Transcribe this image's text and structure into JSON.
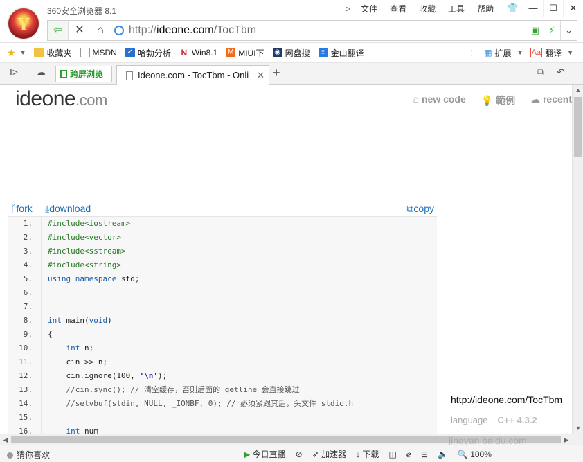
{
  "app": {
    "title": "360安全浏览器 8.1",
    "logo_glyph": "Y",
    "menu": [
      "文件",
      "查看",
      "收藏",
      "工具",
      "帮助"
    ],
    "window_buttons": [
      "👕",
      "—",
      "☐",
      "✕"
    ]
  },
  "address_bar": {
    "scheme": "http://",
    "host": "ideone.com",
    "path": "/TocTbm",
    "back_glyph": "⇦",
    "stop_glyph": "✕",
    "home_glyph": "⌂"
  },
  "favorites": [
    {
      "label": "收藏夹",
      "icon": "folder-icon",
      "color": "#f3c242",
      "glyph": ""
    },
    {
      "label": "MSDN",
      "icon": "page-icon",
      "color": "#9a9a9a",
      "glyph": ""
    },
    {
      "label": "哈勃分析",
      "icon": "shield-icon",
      "color": "#2a6fd0",
      "glyph": "✓"
    },
    {
      "label": "Win8.1",
      "icon": "n-logo-icon",
      "color": "#c1272d",
      "glyph": "N"
    },
    {
      "label": "MIUI下",
      "icon": "miui-icon",
      "color": "#f26b1d",
      "glyph": "M"
    },
    {
      "label": "网盘搜",
      "icon": "search-paw-icon",
      "color": "#1f3b6b",
      "glyph": "◉"
    },
    {
      "label": "金山翻译",
      "icon": "translate-icon",
      "color": "#2a7be0",
      "glyph": "☺"
    }
  ],
  "favbar_right": {
    "extend": "扩展",
    "translate": "翻译"
  },
  "tabs": {
    "split_label": "跨屏浏览",
    "active_title": "Ideone.com - TocTbm - Onli"
  },
  "site": {
    "brand_main": "ideone",
    "brand_tld": ".com",
    "nav": [
      "new code",
      "範例",
      "recent"
    ],
    "actions": {
      "fork": "fork",
      "download": "download",
      "copy": "copy"
    },
    "code_lines": [
      {
        "n": "1.",
        "html": "<span class=\"pp\">#include&lt;iostream&gt;</span>"
      },
      {
        "n": "2.",
        "html": "<span class=\"pp\">#include&lt;vector&gt;</span>"
      },
      {
        "n": "3.",
        "html": "<span class=\"pp\">#include&lt;sstream&gt;</span>"
      },
      {
        "n": "4.",
        "html": "<span class=\"pp\">#include&lt;string&gt;</span>"
      },
      {
        "n": "5.",
        "html": "<span class=\"kw\">using namespace</span> std;"
      },
      {
        "n": "6.",
        "html": ""
      },
      {
        "n": "7.",
        "html": ""
      },
      {
        "n": "8.",
        "html": "<span class=\"kw\">int</span> main(<span class=\"kw\">void</span>)"
      },
      {
        "n": "9.",
        "html": "{"
      },
      {
        "n": "10.",
        "html": "    <span class=\"kw\">int</span> n;"
      },
      {
        "n": "11.",
        "html": "    cin &gt;&gt; n;"
      },
      {
        "n": "12.",
        "html": "    cin.ignore(100, <span class=\"st\">'\\n'</span>);"
      },
      {
        "n": "13.",
        "html": "    <span class=\"cm\">//cin.sync(); // 清空缓存，否则后面的 getline 会直接跳过</span>"
      },
      {
        "n": "14.",
        "html": "    <span class=\"cm\">//setvbuf(stdin, NULL, _IONBF, 0); // 必须紧跟其后，头文件 stdio.h</span>"
      },
      {
        "n": "15.",
        "html": ""
      },
      {
        "n": "16.",
        "html": "    <span class=\"kw\">int</span> num"
      }
    ],
    "link_url": "http://ideone.com/TocTbm",
    "language_label": "language",
    "language_value": "C++ 4.3.2"
  },
  "status": {
    "left": "猜你喜欢",
    "live": "今日直播",
    "accelerate": "加速器",
    "download": "下载",
    "zoom": "100%"
  },
  "watermark": "jingyan.baidu.com"
}
